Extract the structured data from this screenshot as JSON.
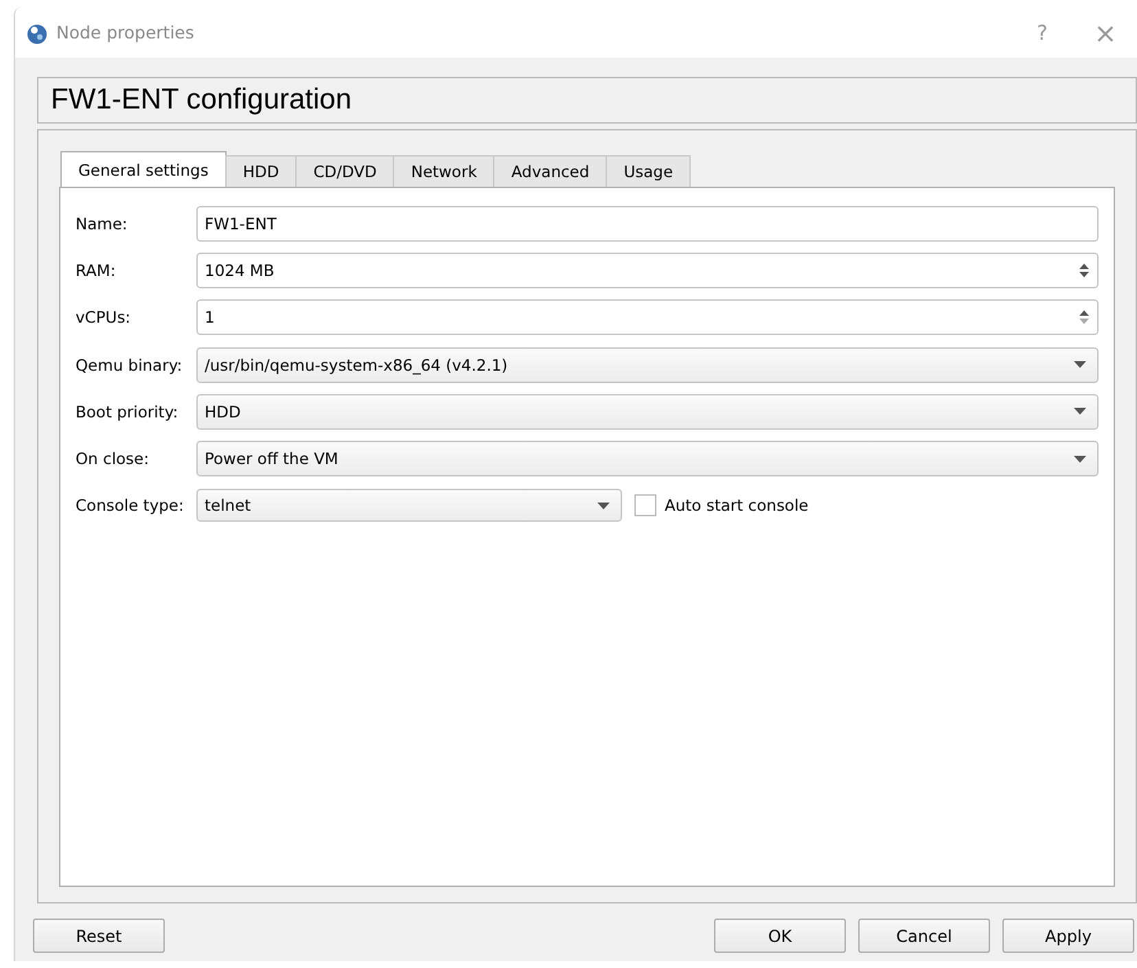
{
  "window": {
    "title": "Node properties",
    "help": "?",
    "close": "×"
  },
  "heading": "FW1-ENT configuration",
  "tabs": [
    {
      "label": "General settings",
      "selected": true
    },
    {
      "label": "HDD",
      "selected": false
    },
    {
      "label": "CD/DVD",
      "selected": false
    },
    {
      "label": "Network",
      "selected": false
    },
    {
      "label": "Advanced",
      "selected": false
    },
    {
      "label": "Usage",
      "selected": false
    }
  ],
  "fields": [
    {
      "label": "Name:",
      "kind": "text",
      "value": "FW1-ENT"
    },
    {
      "label": "RAM:",
      "kind": "spin",
      "value": "1024 MB"
    },
    {
      "label": "vCPUs:",
      "kind": "spin",
      "value": "1"
    },
    {
      "label": "Qemu binary:",
      "kind": "combo",
      "value": "/usr/bin/qemu-system-x86_64 (v4.2.1)"
    },
    {
      "label": "Boot priority:",
      "kind": "combo",
      "value": "HDD"
    },
    {
      "label": "On close:",
      "kind": "combo",
      "value": "Power off the VM"
    },
    {
      "label": "Console type:",
      "kind": "combo_check",
      "value": "telnet",
      "check_label": "Auto start console",
      "checked": false
    }
  ],
  "buttons": {
    "left": [
      "Reset"
    ],
    "right": [
      "OK",
      "Cancel",
      "Apply"
    ]
  }
}
